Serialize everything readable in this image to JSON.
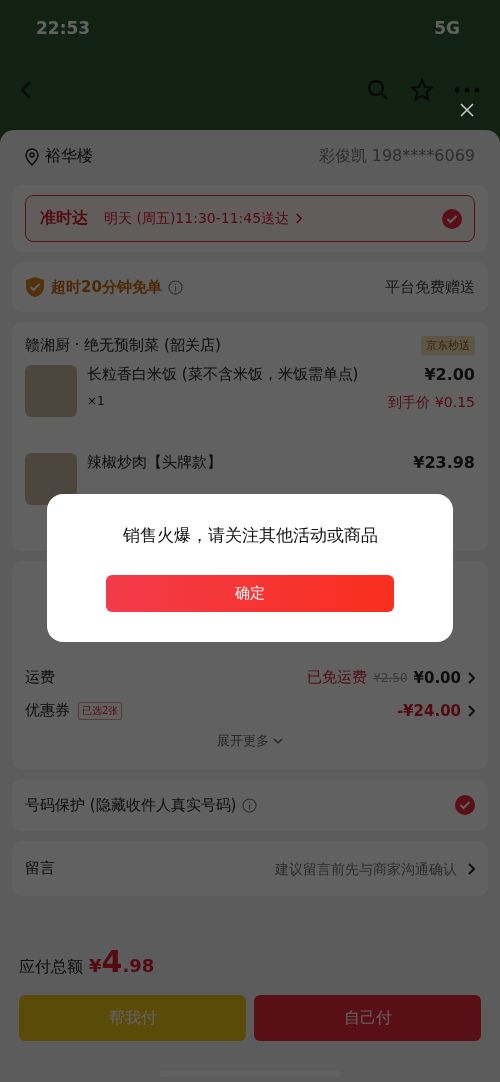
{
  "status_bar": {
    "time": "22:53",
    "network": "5G"
  },
  "address": {
    "place": "裕华楼",
    "contact": "彩俊凯 198****6069"
  },
  "delivery": {
    "label": "准时达",
    "time": "明天 (周五)11:30-11:45送达",
    "selected": true
  },
  "guarantee": {
    "label": "超时20分钟免单",
    "note": "平台免费赠送"
  },
  "store": {
    "name": "赣湘厨 · 绝无预制菜 (韶关店)",
    "tag": "京东秒送",
    "items": [
      {
        "name": "长粒香白米饭 (菜不含米饭，米饭需单点)",
        "price": "¥2.00",
        "qty": "×1",
        "final_price": "到手价 ¥0.15"
      },
      {
        "name": "辣椒炒肉【头牌款】",
        "price": "¥23.98"
      }
    ]
  },
  "fees": [
    {
      "label": "运费",
      "note": "已免运费",
      "old_price": "¥2.50",
      "value": "¥0.00",
      "kind": "shipping"
    },
    {
      "label": "优惠券",
      "tag": "已选2张",
      "value": "-¥24.00",
      "kind": "discount"
    }
  ],
  "expand": "展开更多",
  "privacy": {
    "label": "号码保护 (隐藏收件人真实号码)",
    "checked": true
  },
  "message": {
    "label": "留言",
    "placeholder": "建议留言前先与商家沟通确认"
  },
  "total": {
    "label": "应付总额",
    "currency": "¥",
    "integer": "4",
    "decimal": ".98"
  },
  "buttons": [
    "帮我付",
    "自己付"
  ],
  "dialog": {
    "message": "销售火爆，请关注其他活动或商品",
    "confirm": "确定"
  }
}
